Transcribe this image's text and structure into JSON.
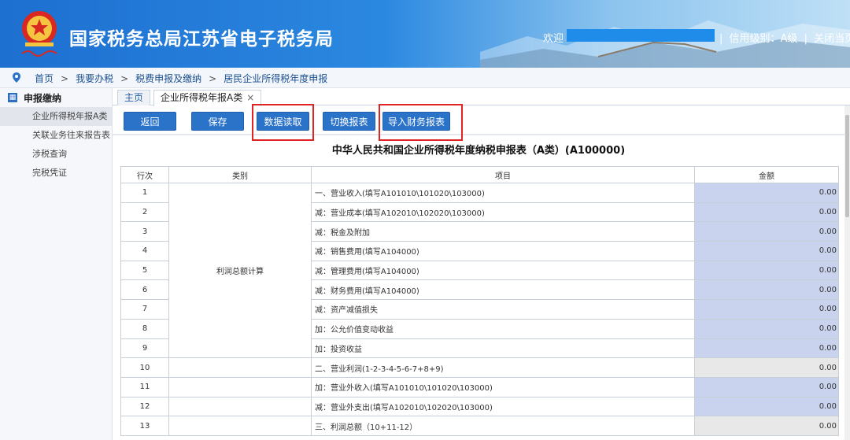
{
  "header": {
    "title": "国家税务总局江苏省电子税务局",
    "welcome": "欢迎",
    "links": [
      "信用级别：A级",
      "关闭当页"
    ],
    "separator": "|",
    "emblem_icon": "tax-emblem-icon"
  },
  "breadcrumb": {
    "items": [
      "首页",
      "我要办税",
      "税费申报及缴纳",
      "居民企业所得税年度申报"
    ],
    "separator": ">"
  },
  "sidebar": {
    "heading": "申报缴纳",
    "items": [
      {
        "label": "企业所得税年报A类",
        "active": true
      },
      {
        "label": "关联业务往来报告表",
        "active": false
      },
      {
        "label": "涉税查询",
        "active": false
      },
      {
        "label": "完税凭证",
        "active": false
      }
    ]
  },
  "tabs": [
    {
      "label": "主页"
    },
    {
      "label": "企业所得税年报A类",
      "close": "×"
    }
  ],
  "toolbar": {
    "buttons": [
      "返回",
      "保存",
      "数据读取",
      "切换报表",
      "导入财务报表"
    ]
  },
  "form": {
    "title": "中华人民共和国企业所得税年度纳税申报表（A类）(A100000)",
    "headers": [
      "行次",
      "类别",
      "项目",
      "金额"
    ],
    "category": "利润总额计算",
    "rows": [
      {
        "no": "1",
        "item": "一、营业收入(填写A101010\\101020\\103000)",
        "amount": "0.00",
        "gray": false
      },
      {
        "no": "2",
        "item": "减：营业成本(填写A102010\\102020\\103000)",
        "amount": "0.00",
        "gray": false
      },
      {
        "no": "3",
        "item": "减：税金及附加",
        "amount": "0.00",
        "gray": false
      },
      {
        "no": "4",
        "item": "减：销售费用(填写A104000)",
        "amount": "0.00",
        "gray": false
      },
      {
        "no": "5",
        "item": "减：管理费用(填写A104000)",
        "amount": "0.00",
        "gray": false
      },
      {
        "no": "6",
        "item": "减：财务费用(填写A104000)",
        "amount": "0.00",
        "gray": false
      },
      {
        "no": "7",
        "item": "减：资产减值损失",
        "amount": "0.00",
        "gray": false
      },
      {
        "no": "8",
        "item": "加：公允价值变动收益",
        "amount": "0.00",
        "gray": false
      },
      {
        "no": "9",
        "item": "加：投资收益",
        "amount": "0.00",
        "gray": false
      },
      {
        "no": "10",
        "item": "二、营业利润(1-2-3-4-5-6-7+8+9)",
        "amount": "0.00",
        "gray": true
      },
      {
        "no": "11",
        "item": "加：营业外收入(填写A101010\\101020\\103000)",
        "amount": "0.00",
        "gray": false
      },
      {
        "no": "12",
        "item": "减：营业外支出(填写A102010\\102020\\103000)",
        "amount": "0.00",
        "gray": false
      },
      {
        "no": "13",
        "item": "三、利润总额（10+11-12）",
        "amount": "0.00",
        "gray": true
      }
    ]
  },
  "colors": {
    "header_blue": "#1d6fd0",
    "button_blue": "#2b73c9",
    "amount_cell": "#c9d3ee",
    "computed_cell": "#e8e8e8",
    "highlight_red": "#e02424"
  }
}
